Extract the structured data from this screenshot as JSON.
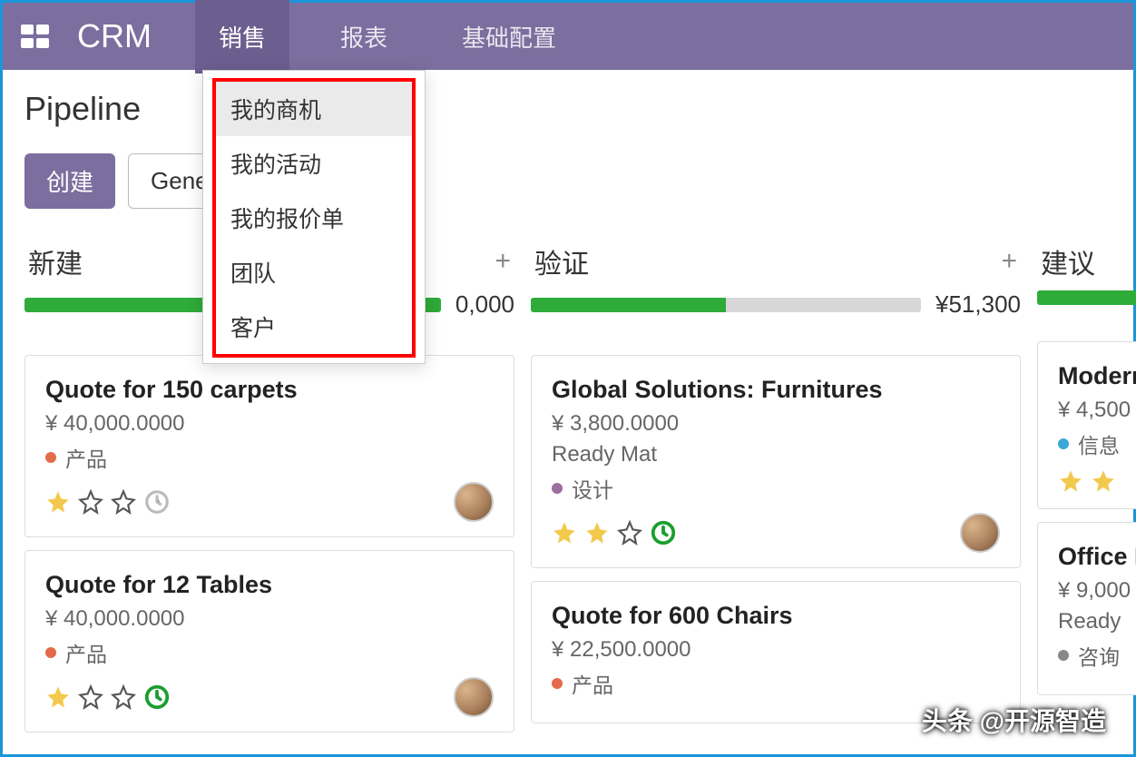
{
  "app": {
    "name": "CRM"
  },
  "nav": {
    "items": [
      {
        "label": "销售",
        "active": true
      },
      {
        "label": "报表"
      },
      {
        "label": "基础配置"
      }
    ]
  },
  "dropdown": {
    "items": [
      {
        "label": "我的商机",
        "hover": true
      },
      {
        "label": "我的活动"
      },
      {
        "label": "我的报价单"
      },
      {
        "label": "团队"
      },
      {
        "label": "客户"
      }
    ]
  },
  "page": {
    "title": "Pipeline"
  },
  "actions": {
    "create": "创建",
    "generate": "Gener"
  },
  "columns": [
    {
      "title": "新建",
      "amount": "0,000",
      "bar_pct": 100,
      "cards": [
        {
          "title": "Quote for 150 carpets",
          "amount": "¥ 40,000.0000",
          "tag": {
            "color": "#e36b4b",
            "label": "产品"
          },
          "stars": 1,
          "clock": "gray"
        },
        {
          "title": "Quote for 12 Tables",
          "amount": "¥ 40,000.0000",
          "tag": {
            "color": "#e36b4b",
            "label": "产品"
          },
          "stars": 1,
          "clock": "green"
        }
      ]
    },
    {
      "title": "验证",
      "amount": "¥51,300",
      "bar_pct": 50,
      "cards": [
        {
          "title": "Global Solutions: Furnitures",
          "amount": "¥ 3,800.0000",
          "sub": "Ready Mat",
          "tag": {
            "color": "#9b6f9e",
            "label": "设计"
          },
          "stars": 2,
          "clock": "green"
        },
        {
          "title": "Quote for 600 Chairs",
          "amount": "¥ 22,500.0000",
          "tag": {
            "color": "#e36b4b",
            "label": "产品"
          },
          "stars": 0
        }
      ]
    },
    {
      "title": "建议",
      "amount": "",
      "bar_pct": 100,
      "cards": [
        {
          "title": "Moderr",
          "amount": "¥ 4,500",
          "tag": {
            "color": "#3aa8d8",
            "label": "信息"
          },
          "stars": 2
        },
        {
          "title": "Office I",
          "amount": "¥ 9,000",
          "sub": "Ready",
          "tag": {
            "color": "#888",
            "label": "咨询"
          }
        }
      ]
    }
  ],
  "watermark": "头条 @开源智造"
}
